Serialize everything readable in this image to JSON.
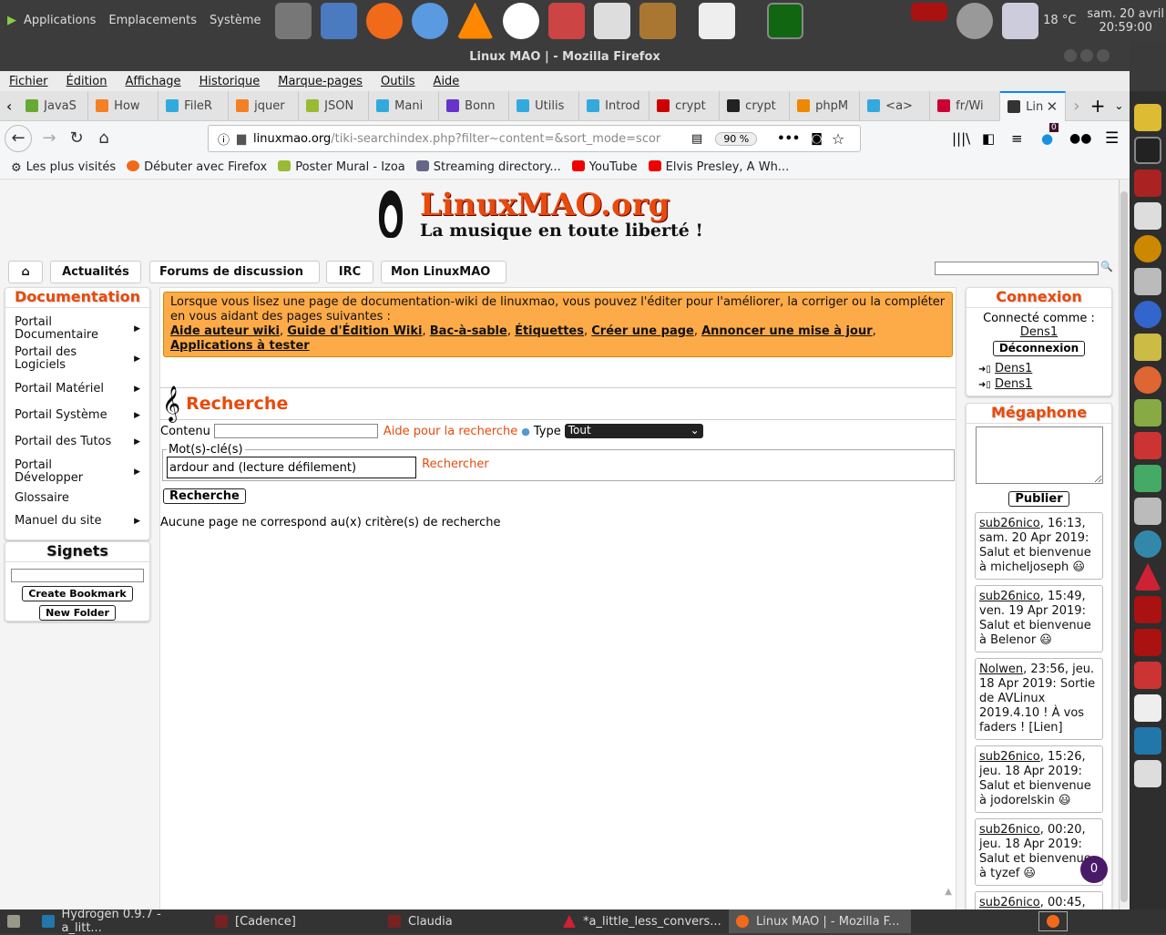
{
  "panel": {
    "menus": [
      "Applications",
      "Emplacements",
      "Système"
    ],
    "weather": "18 °C",
    "date": "sam. 20 avril",
    "time": "20:59:00"
  },
  "window_title": "Linux MAO | - Mozilla Firefox",
  "menubar": [
    "Fichier",
    "Édition",
    "Affichage",
    "Historique",
    "Marque-pages",
    "Outils",
    "Aide"
  ],
  "tabs": [
    {
      "label": "JavaS",
      "color": "#6a3"
    },
    {
      "label": "How",
      "color": "#f48024"
    },
    {
      "label": "FileR",
      "color": "#3ad"
    },
    {
      "label": "jquer",
      "color": "#f48024"
    },
    {
      "label": "JSON",
      "color": "#9b3"
    },
    {
      "label": "Mani",
      "color": "#3ad"
    },
    {
      "label": "Bonn",
      "color": "#63c"
    },
    {
      "label": "Utilis",
      "color": "#3ad"
    },
    {
      "label": "Introd",
      "color": "#3ad"
    },
    {
      "label": "crypt",
      "color": "#c00"
    },
    {
      "label": "crypt",
      "color": "#222"
    },
    {
      "label": "phpM",
      "color": "#e80"
    },
    {
      "label": "<a>",
      "color": "#3ad"
    },
    {
      "label": "fr/Wi",
      "color": "#c03"
    },
    {
      "label": "Lin",
      "color": "#333",
      "active": true
    }
  ],
  "nav": {
    "url_host": "linuxmao.org",
    "url_path": "/tiki-searchindex.php?filter~content=&sort_mode=scor",
    "zoom": "90 %",
    "badge": "0"
  },
  "bookmarks": [
    "Les plus visités",
    "Débuter avec Firefox",
    "Poster Mural - Izoa",
    "Streaming directory...",
    "YouTube",
    "Elvis Presley, A Wh..."
  ],
  "site": {
    "logo_title": "LinuxMAO.org",
    "logo_tagline": "La musique en toute liberté !",
    "nav": [
      "Actualités",
      "Forums de discussion",
      "IRC",
      "Mon LinuxMAO"
    ]
  },
  "sidebar": {
    "title": "Documentation",
    "items": [
      {
        "label": "Portail Documentaire",
        "arrow": true
      },
      {
        "label": "Portail des Logiciels",
        "arrow": true
      },
      {
        "label": "Portail Matériel",
        "arrow": true
      },
      {
        "label": "Portail Système",
        "arrow": true
      },
      {
        "label": "Portail des Tutos",
        "arrow": true
      },
      {
        "label": "Portail Développer",
        "arrow": true
      },
      {
        "label": "Glossaire",
        "arrow": false
      },
      {
        "label": "Manuel du site",
        "arrow": true
      }
    ],
    "signets_title": "Signets",
    "create_bookmark": "Create Bookmark",
    "new_folder": "New Folder"
  },
  "notice": {
    "text": "Lorsque vous lisez une page de documentation-wiki de linuxmao, vous pouvez l'éditer pour l'améliorer, la corriger ou la compléter en vous aidant des pages suivantes :",
    "links": [
      "Aide auteur wiki",
      "Guide d'Édition Wiki",
      "Bac-à-sable",
      "Étiquettes",
      "Créer une page",
      "Annoncer une mise à jour",
      "Applications à tester"
    ]
  },
  "search": {
    "title": "Recherche",
    "content_label": "Contenu",
    "help_link": "Aide pour la recherche",
    "type_label": "Type",
    "type_value": "Tout",
    "keywords_legend": "Mot(s)-clé(s)",
    "keywords_value": "ardour and (lecture défilement)",
    "rechercher_link": "Rechercher",
    "submit": "Recherche",
    "no_results": "Aucune page ne correspond au(x) critère(s) de recherche"
  },
  "connexion": {
    "title": "Connexion",
    "connected_as": "Connecté comme :",
    "user": "Dens1",
    "logout": "Déconnexion",
    "recent": [
      "Dens1",
      "Dens1"
    ]
  },
  "megaphone": {
    "title": "Mégaphone",
    "publish": "Publier",
    "shouts": [
      {
        "user": "sub26nico",
        "text": ", 16:13, sam. 20 Apr 2019: Salut et bienvenue à micheljoseph 😃"
      },
      {
        "user": "sub26nico",
        "text": ", 15:49, ven. 19 Apr 2019: Salut et bienvenue à Belenor 😃"
      },
      {
        "user": "Nolwen",
        "text": ", 23:56, jeu. 18 Apr 2019: Sortie de AVLinux 2019.4.10 ! À vos faders ! [Lien]"
      },
      {
        "user": "sub26nico",
        "text": ", 15:26, jeu. 18 Apr 2019: Salut et bienvenue à jodorelskin 😃"
      },
      {
        "user": "sub26nico",
        "text": ", 00:20, jeu. 18 Apr 2019: Salut et bienvenue à tyzef 😃"
      },
      {
        "user": "sub26nico",
        "text": ", 00:45,"
      }
    ],
    "notif_count": "0"
  },
  "taskbar": [
    "Hydrogen 0.9.7 - a_litt...",
    "[Cadence]",
    "Claudia",
    "*a_little_less_convers...",
    "Linux MAO | - Mozilla F..."
  ]
}
